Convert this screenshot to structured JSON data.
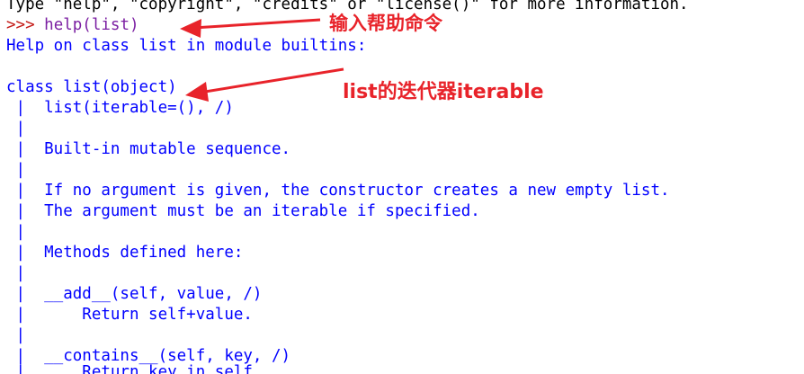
{
  "console": {
    "lines": [
      {
        "kind": "banner",
        "text": "Type \"help\", \"copyright\", \"credits\" or \"license()\" for more information."
      },
      {
        "kind": "prompt",
        "prompt": ">>> ",
        "command": "help(list)"
      },
      {
        "kind": "output",
        "text": "Help on class list in module builtins:"
      },
      {
        "kind": "output",
        "text": ""
      },
      {
        "kind": "output",
        "text": "class list(object)"
      },
      {
        "kind": "output",
        "text": " |  list(iterable=(), /)"
      },
      {
        "kind": "output",
        "text": " |  "
      },
      {
        "kind": "output",
        "text": " |  Built-in mutable sequence."
      },
      {
        "kind": "output",
        "text": " |  "
      },
      {
        "kind": "output",
        "text": " |  If no argument is given, the constructor creates a new empty list."
      },
      {
        "kind": "output",
        "text": " |  The argument must be an iterable if specified."
      },
      {
        "kind": "output",
        "text": " |  "
      },
      {
        "kind": "output",
        "text": " |  Methods defined here:"
      },
      {
        "kind": "output",
        "text": " |  "
      },
      {
        "kind": "output",
        "text": " |  __add__(self, value, /)"
      },
      {
        "kind": "output",
        "text": " |      Return self+value."
      },
      {
        "kind": "output",
        "text": " |  "
      },
      {
        "kind": "output",
        "text": " |  __contains__(self, key, /)"
      },
      {
        "kind": "output",
        "text": " |      Return key in self."
      }
    ]
  },
  "annotations": [
    {
      "text": "输入帮助命令"
    },
    {
      "text": "list的迭代器iterable"
    }
  ],
  "colors": {
    "output": "#0000ff",
    "prompt": "#c41a16",
    "command": "#7b1fa2",
    "banner": "#000000",
    "annotation": "#e8232a"
  }
}
